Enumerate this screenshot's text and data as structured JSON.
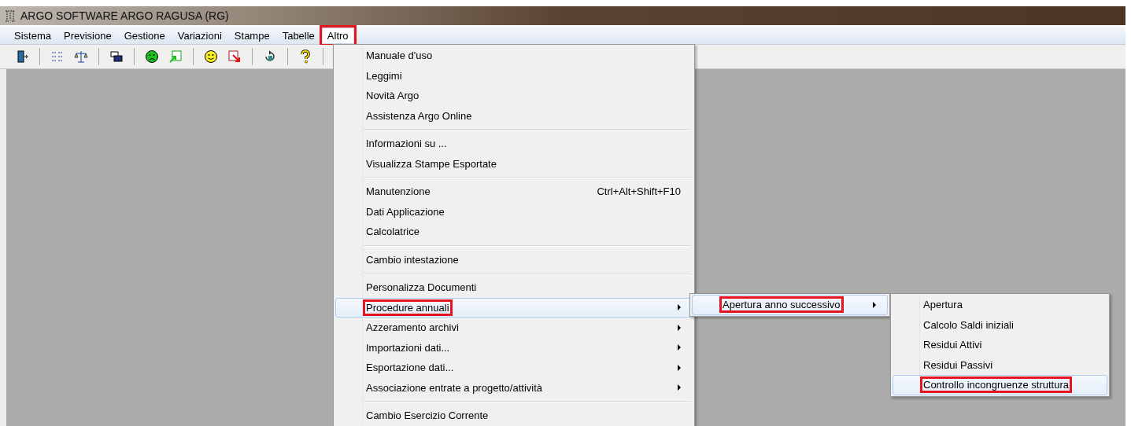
{
  "window": {
    "title": "ARGO SOFTWARE ARGO RAGUSA (RG)"
  },
  "menubar": [
    {
      "label": "Sistema",
      "selected": false,
      "annotated": false
    },
    {
      "label": "Previsione",
      "selected": false,
      "annotated": false
    },
    {
      "label": "Gestione",
      "selected": false,
      "annotated": false
    },
    {
      "label": "Variazioni",
      "selected": false,
      "annotated": false
    },
    {
      "label": "Stampe",
      "selected": false,
      "annotated": false
    },
    {
      "label": "Tabelle",
      "selected": false,
      "annotated": false
    },
    {
      "label": "Altro",
      "selected": true,
      "annotated": true
    }
  ],
  "menu": {
    "groups": [
      [
        {
          "label": "Manuale d'uso",
          "submenu": false,
          "selected": false,
          "annotated": false
        },
        {
          "label": "Leggimi",
          "submenu": false,
          "selected": false,
          "annotated": false
        },
        {
          "label": "Novità Argo",
          "submenu": false,
          "selected": false,
          "annotated": false
        },
        {
          "label": "Assistenza Argo Online",
          "submenu": false,
          "selected": false,
          "annotated": false
        }
      ],
      [
        {
          "label": "Informazioni su ...",
          "submenu": false,
          "selected": false,
          "annotated": false
        },
        {
          "label": "Visualizza Stampe Esportate",
          "submenu": false,
          "selected": false,
          "annotated": false
        }
      ],
      [
        {
          "label": "Manutenzione",
          "shortcut": "Ctrl+Alt+Shift+F10",
          "submenu": false,
          "selected": false,
          "annotated": false
        },
        {
          "label": "Dati Applicazione",
          "submenu": false,
          "selected": false,
          "annotated": false
        },
        {
          "label": "Calcolatrice",
          "submenu": false,
          "selected": false,
          "annotated": false
        }
      ],
      [
        {
          "label": "Cambio intestazione",
          "submenu": false,
          "selected": false,
          "annotated": false
        }
      ],
      [
        {
          "label": "Personalizza Documenti",
          "submenu": false,
          "selected": false,
          "annotated": false
        },
        {
          "label": "Procedure annuali",
          "submenu": true,
          "selected": true,
          "annotated": true
        },
        {
          "label": "Azzeramento archivi",
          "submenu": true,
          "selected": false,
          "annotated": false
        },
        {
          "label": "Importazioni dati...",
          "submenu": true,
          "selected": false,
          "annotated": false
        },
        {
          "label": "Esportazione dati...",
          "submenu": true,
          "selected": false,
          "annotated": false
        },
        {
          "label": "Associazione entrate a progetto/attività",
          "submenu": true,
          "selected": false,
          "annotated": false
        }
      ],
      [
        {
          "label": "Cambio Esercizio Corrente",
          "submenu": false,
          "selected": false,
          "annotated": false
        }
      ]
    ]
  },
  "submenu_1": [
    {
      "label": "Apertura anno successivo",
      "submenu": true,
      "selected": true,
      "annotated": true
    }
  ],
  "submenu_2": [
    {
      "label": "Apertura",
      "submenu": false,
      "selected": false,
      "annotated": false
    },
    {
      "label": "Calcolo Saldi iniziali",
      "submenu": false,
      "selected": false,
      "annotated": false
    },
    {
      "label": "Residui Attivi",
      "submenu": false,
      "selected": false,
      "annotated": false
    },
    {
      "label": "Residui Passivi",
      "submenu": false,
      "selected": false,
      "annotated": false
    },
    {
      "label": "Controllo incongruenze struttura",
      "submenu": false,
      "selected": true,
      "annotated": true
    }
  ]
}
